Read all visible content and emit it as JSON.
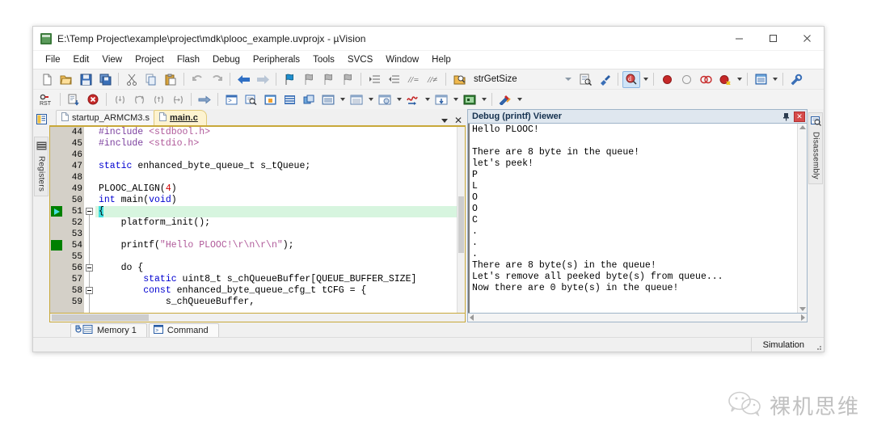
{
  "window": {
    "title": "E:\\Temp Project\\example\\project\\mdk\\plooc_example.uvprojx - µVision",
    "app_icon": "uvision-icon",
    "controls": {
      "minimize": "minimize-icon",
      "maximize": "maximize-icon",
      "close": "close-icon"
    }
  },
  "menu": {
    "items": [
      {
        "label": "File"
      },
      {
        "label": "Edit"
      },
      {
        "label": "View"
      },
      {
        "label": "Project"
      },
      {
        "label": "Flash"
      },
      {
        "label": "Debug"
      },
      {
        "label": "Peripherals"
      },
      {
        "label": "Tools"
      },
      {
        "label": "SVCS"
      },
      {
        "label": "Window"
      },
      {
        "label": "Help"
      }
    ]
  },
  "toolbar": {
    "search_value": "strGetSize",
    "search_placeholder": "",
    "row1_icons": [
      "new-file-icon",
      "open-file-icon",
      "save-icon",
      "save-all-icon",
      "cut-icon",
      "copy-icon",
      "paste-icon",
      "undo-icon",
      "redo-icon",
      "navigate-back-icon",
      "navigate-forward-icon",
      "bookmark-toggle-icon",
      "bookmark-prev-icon",
      "bookmark-next-icon",
      "bookmark-clear-icon",
      "indent-icon",
      "outdent-icon",
      "comment-icon",
      "uncomment-icon",
      "find-in-files-icon"
    ],
    "row1_right_icons": [
      "combo-arrow-icon",
      "find-icon",
      "configure-icon",
      "magnifier-d-icon",
      "breakpoint-icon",
      "breakpoint-disable-icon",
      "breakpoint-disable-all-icon",
      "breakpoint-kill-icon",
      "window-layout-icon",
      "configure-tools-icon"
    ],
    "row2_icons": [
      "reset-icon",
      "build-icon",
      "stop-build-icon",
      "step-into-icon",
      "step-over-icon",
      "step-out-icon",
      "run-to-cursor-icon",
      "show-next-statement-icon",
      "command-window-icon",
      "disassembly-window-icon",
      "symbols-window-icon",
      "registers-window-icon",
      "call-stack-icon",
      "watch-windows-icon",
      "memory-windows-icon",
      "serial-windows-icon",
      "analysis-windows-icon",
      "trace-windows-icon",
      "system-viewer-icon",
      "toolbox-icon"
    ]
  },
  "left_dock": {
    "tabs": [
      {
        "label": "",
        "icon": "project-window-icon"
      },
      {
        "label": "Registers",
        "icon": "registers-icon"
      }
    ]
  },
  "right_dock": {
    "tabs": [
      {
        "label": "Disassembly",
        "icon": "disassembly-icon"
      }
    ]
  },
  "editor": {
    "tabs": [
      {
        "label": "startup_ARMCM3.s",
        "active": false,
        "icon": "document-icon"
      },
      {
        "label": "main.c",
        "active": true,
        "icon": "document-icon"
      }
    ],
    "tab_menu_icon": "chevron-down-icon",
    "tab_close_icon": "close-icon",
    "first_line_number": 44,
    "lines": [
      {
        "n": 44,
        "tokens": [
          {
            "t": "#include ",
            "c": "pre"
          },
          {
            "t": "<stdbool.h>",
            "c": "str"
          }
        ]
      },
      {
        "n": 45,
        "tokens": [
          {
            "t": "#include ",
            "c": "pre"
          },
          {
            "t": "<stdio.h>",
            "c": "str"
          }
        ]
      },
      {
        "n": 46,
        "tokens": []
      },
      {
        "n": 47,
        "tokens": [
          {
            "t": "static",
            "c": "kw"
          },
          {
            "t": " enhanced_byte_queue_t s_tQueue;",
            "c": ""
          }
        ]
      },
      {
        "n": 48,
        "tokens": []
      },
      {
        "n": 49,
        "tokens": [
          {
            "t": "PLOOC_ALIGN(",
            "c": ""
          },
          {
            "t": "4",
            "c": "num"
          },
          {
            "t": ")",
            "c": ""
          }
        ]
      },
      {
        "n": 50,
        "tokens": [
          {
            "t": "int",
            "c": "kw"
          },
          {
            "t": " main(",
            "c": ""
          },
          {
            "t": "void",
            "c": "kw"
          },
          {
            "t": ")",
            "c": ""
          }
        ]
      },
      {
        "n": 51,
        "tokens": [
          {
            "t": "{",
            "c": "caret"
          }
        ],
        "highlight": true,
        "fold": true,
        "marker": "arrow"
      },
      {
        "n": 52,
        "tokens": [
          {
            "t": "    platform_init();",
            "c": ""
          }
        ]
      },
      {
        "n": 53,
        "tokens": []
      },
      {
        "n": 54,
        "tokens": [
          {
            "t": "    printf(",
            "c": ""
          },
          {
            "t": "\"Hello PLOOC!\\r\\n\\r\\n\"",
            "c": "str"
          },
          {
            "t": ");",
            "c": ""
          }
        ],
        "marker": "square"
      },
      {
        "n": 55,
        "tokens": []
      },
      {
        "n": 56,
        "tokens": [
          {
            "t": "    do {",
            "c": ""
          }
        ],
        "fold": true
      },
      {
        "n": 57,
        "tokens": [
          {
            "t": "        ",
            "c": ""
          },
          {
            "t": "static",
            "c": "kw"
          },
          {
            "t": " uint8_t s_chQueueBuffer[QUEUE_BUFFER_SIZE]",
            "c": ""
          }
        ]
      },
      {
        "n": 58,
        "tokens": [
          {
            "t": "        ",
            "c": ""
          },
          {
            "t": "const",
            "c": "kw"
          },
          {
            "t": " enhanced_byte_queue_cfg_t tCFG = {",
            "c": ""
          }
        ],
        "fold": true
      },
      {
        "n": 59,
        "tokens": [
          {
            "t": "            s_chQueueBuffer,",
            "c": ""
          }
        ]
      }
    ]
  },
  "debug_viewer": {
    "title": "Debug (printf) Viewer",
    "pin_icon": "pin-icon",
    "close_icon": "close-icon",
    "scroll_up_icon": "scroll-up-icon",
    "scroll_down_icon": "scroll-down-icon",
    "scroll_left_icon": "scroll-left-icon",
    "scroll_right_icon": "scroll-right-icon",
    "lines": [
      "Hello PLOOC!",
      "",
      "There are 8 byte in the queue!",
      "let's peek!",
      "P",
      "L",
      "O",
      "O",
      "C",
      ".",
      ".",
      ".",
      "There are 8 byte(s) in the queue!",
      "Let's remove all peeked byte(s) from queue...",
      "Now there are 0 byte(s) in the queue!"
    ]
  },
  "bottom_tabs": {
    "items": [
      {
        "label": "Memory 1",
        "icon": "memory-icon",
        "active": false
      },
      {
        "label": "Command",
        "icon": "command-icon",
        "active": true
      }
    ]
  },
  "statusbar": {
    "simulation": "Simulation",
    "grip_icon": "resize-grip-icon"
  },
  "watermark": {
    "text": "裸机思维",
    "icon": "wechat-icon"
  },
  "colors": {
    "accent_tab": "#fdf3d0",
    "editor_border": "#c8a83a",
    "highlight_line": "#d7f5df",
    "breakpoint_green": "#008000",
    "keyword_blue": "#0000d0",
    "string_magenta": "#b05a9a",
    "preproc_purple": "#7b3f9e",
    "number_red": "#d00000",
    "dbg_titlebar": "#dfe7ef",
    "close_red": "#d64a4a"
  }
}
